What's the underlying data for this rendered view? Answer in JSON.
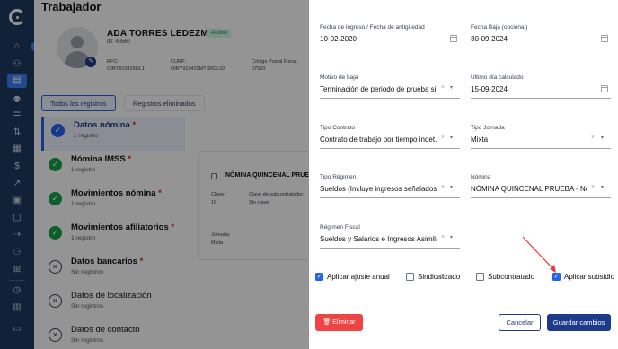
{
  "nav": {
    "icons": [
      "home-icon",
      "users-icon",
      "id-card-icon",
      "people-icon",
      "list-icon",
      "adjust-icon",
      "doc-icon",
      "money-icon",
      "document-icon",
      "chart-icon",
      "doc-plus-icon",
      "folder-icon",
      "share-icon",
      "group-icon",
      "org-icon",
      "settings-icon",
      "clock-icon",
      "report-icon",
      "credit-card-icon"
    ]
  },
  "page": {
    "title": "Trabajador",
    "employee": {
      "name": "ADA TORRES LEDEZMA",
      "status": "Activo",
      "id_label": "ID: 46560",
      "rfc_label": "RFC:",
      "rfc_value": "OIRY910429UL1",
      "curp_label": "CURP:",
      "curp_value": "OIRY910429MTSRDL02",
      "cp_label": "Código Postal Fiscal:",
      "cp_value": "07550"
    },
    "tabs": [
      "Todos los registros",
      "Registros eliminados"
    ],
    "sections": [
      {
        "label": "Datos nómina",
        "required": "*",
        "sub": "1 registro"
      },
      {
        "label": "Nómina IMSS",
        "required": "*",
        "sub": "1 registro"
      },
      {
        "label": "Movimientos nómina",
        "required": "*",
        "sub": "1 registro"
      },
      {
        "label": "Movimientos afiliatorios",
        "required": "*",
        "sub": "1 registro"
      },
      {
        "label": "Datos bancarios",
        "required": "*",
        "sub": "Sin registros"
      },
      {
        "label": "Datos de localización",
        "required": "",
        "sub": "Sin registros"
      },
      {
        "label": "Datos de contacto",
        "required": "",
        "sub": "Sin registros"
      }
    ],
    "card": {
      "title": "NÓMINA QUINCENAL PRUE",
      "clave_label": "Clave:",
      "clave_value": "16",
      "subcontratador_label": "Clave de subcontratador:",
      "subcontratador_value": "Sin clave",
      "jornada_label": "Jornada:",
      "jornada_value": "Mixta"
    }
  },
  "drawer": {
    "fields": {
      "fecha_ingreso": {
        "label": "Fecha de ingreso / Fecha de antigüedad",
        "value": "10-02-2020"
      },
      "fecha_baja": {
        "label": "Fecha Baja (opcional)",
        "value": "30-09-2024"
      },
      "motivo_baja": {
        "label": "Motivo de baja",
        "value": "Terminación de periodo de prueba si..."
      },
      "ultimo_dia": {
        "label": "Último día calculado",
        "value": "15-09-2024"
      },
      "tipo_contrato": {
        "label": "Tipo Contrato",
        "value": "Contrato de trabajo por tiempo indet..."
      },
      "tipo_jornada": {
        "label": "Tipo Jornada",
        "value": "Mixta"
      },
      "tipo_regimen": {
        "label": "Tipo Régimen",
        "value": "Sueldos (Incluye ingresos señalados ..."
      },
      "nomina": {
        "label": "Nómina",
        "value": "NÓMINA QUINCENAL PRUEBA - Nor..."
      },
      "regimen_fiscal": {
        "label": "Régimen Fiscal",
        "value": "Sueldos y Salarios e Ingresos Asimila..."
      }
    },
    "checkboxes": {
      "ajuste_anual": {
        "label": "Aplicar ajuste anual",
        "checked": true
      },
      "sindicalizado": {
        "label": "Sindicalizado",
        "checked": false
      },
      "subcontratado": {
        "label": "Subcontratado",
        "checked": false
      },
      "subsidio": {
        "label": "Aplicar subsidio",
        "checked": true
      }
    },
    "buttons": {
      "delete": "Eliminar",
      "cancel": "Cancelar",
      "save": "Guardar cambios"
    },
    "colors": {
      "primary": "#1e3a8a",
      "danger": "#ef4444",
      "accent": "#2563eb",
      "annotation": "#e53935"
    }
  }
}
